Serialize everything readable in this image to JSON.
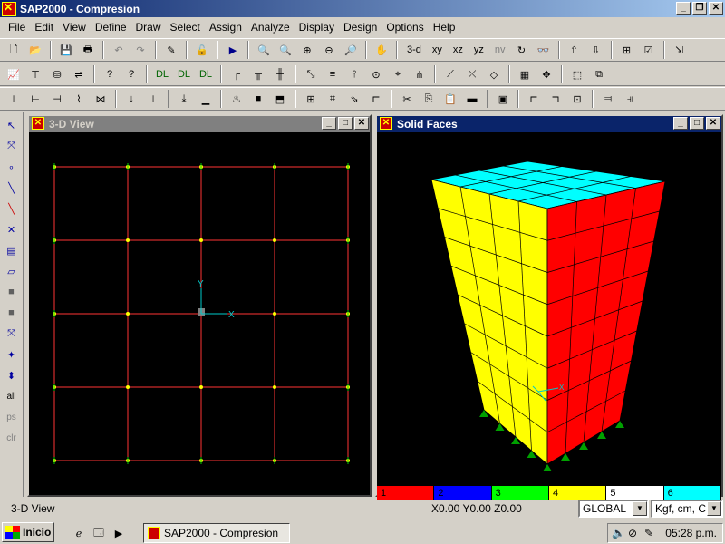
{
  "window": {
    "title": "SAP2000 - Compresion"
  },
  "menu": [
    "File",
    "Edit",
    "View",
    "Define",
    "Draw",
    "Select",
    "Assign",
    "Analyze",
    "Display",
    "Design",
    "Options",
    "Help"
  ],
  "toolbar1": {
    "view_labels": [
      "3-d",
      "xy",
      "xz",
      "yz",
      "nv"
    ]
  },
  "left_tools_labels": {
    "all": "all",
    "ps": "ps",
    "clr": "clr"
  },
  "windows": {
    "left": {
      "title": "3-D View",
      "axis_x": "X",
      "axis_y": "Y"
    },
    "right": {
      "title": "Solid Faces",
      "axis_x": "X"
    }
  },
  "legend": [
    {
      "label": "1",
      "color": "#ff0000"
    },
    {
      "label": "2",
      "color": "#0000ff"
    },
    {
      "label": "3",
      "color": "#00ff00"
    },
    {
      "label": "4",
      "color": "#ffff00"
    },
    {
      "label": "5",
      "color": "#ffffff"
    },
    {
      "label": "6",
      "color": "#00ffff"
    }
  ],
  "statusbar": {
    "view": "3-D View",
    "coords": "X0.00  Y0.00  Z0.00",
    "coord_system": "GLOBAL",
    "units": "Kgf, cm, C"
  },
  "taskbar": {
    "start": "Inicio",
    "task": "SAP2000 - Compresion",
    "clock": "05:28 p.m."
  }
}
